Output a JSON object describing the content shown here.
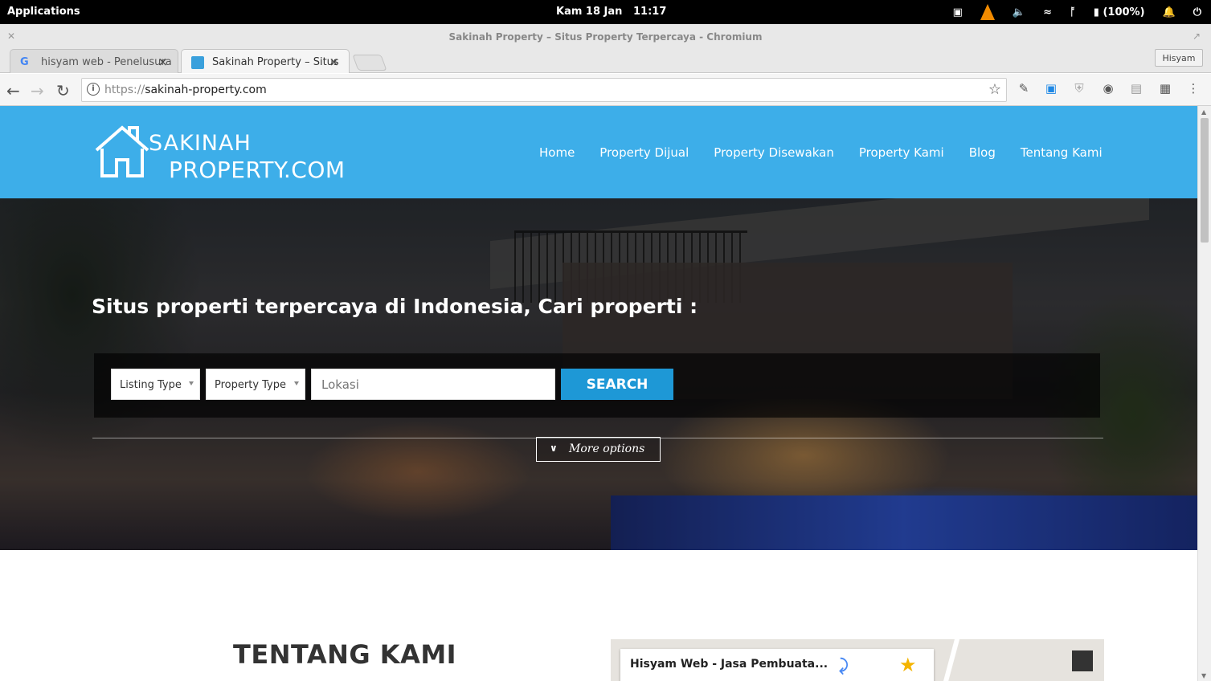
{
  "os": {
    "menu": "Applications",
    "date": "Kam 18 Jan",
    "time": "11:17",
    "battery": "(100%)"
  },
  "window": {
    "title": "Sakinah Property – Situs Property Terpercaya - Chromium",
    "profile": "Hisyam"
  },
  "tabs": [
    {
      "label": "hisyam web - Penelusura",
      "favicon": "google-icon"
    },
    {
      "label": "Sakinah Property – Situs",
      "favicon": "site-icon"
    }
  ],
  "address": {
    "scheme": "https://",
    "host": "sakinah-property.com"
  },
  "site": {
    "logo_line1": "SAKINAH",
    "logo_line2": "PROPERTY.COM",
    "nav": [
      "Home",
      "Property Dijual",
      "Property Disewakan",
      "Property Kami",
      "Blog",
      "Tentang Kami"
    ],
    "hero_title": "Situs properti terpercaya di Indonesia, Cari properti :",
    "listing_type": "Listing Type",
    "property_type": "Property Type",
    "location_placeholder": "Lokasi",
    "search_label": "SEARCH",
    "more_options": "More options",
    "about_title": "TENTANG KAMI",
    "map_place": "Hisyam Web - Jasa Pembuata..."
  },
  "colors": {
    "header_bg": "#3daee9",
    "search_btn": "#1e98d6"
  }
}
